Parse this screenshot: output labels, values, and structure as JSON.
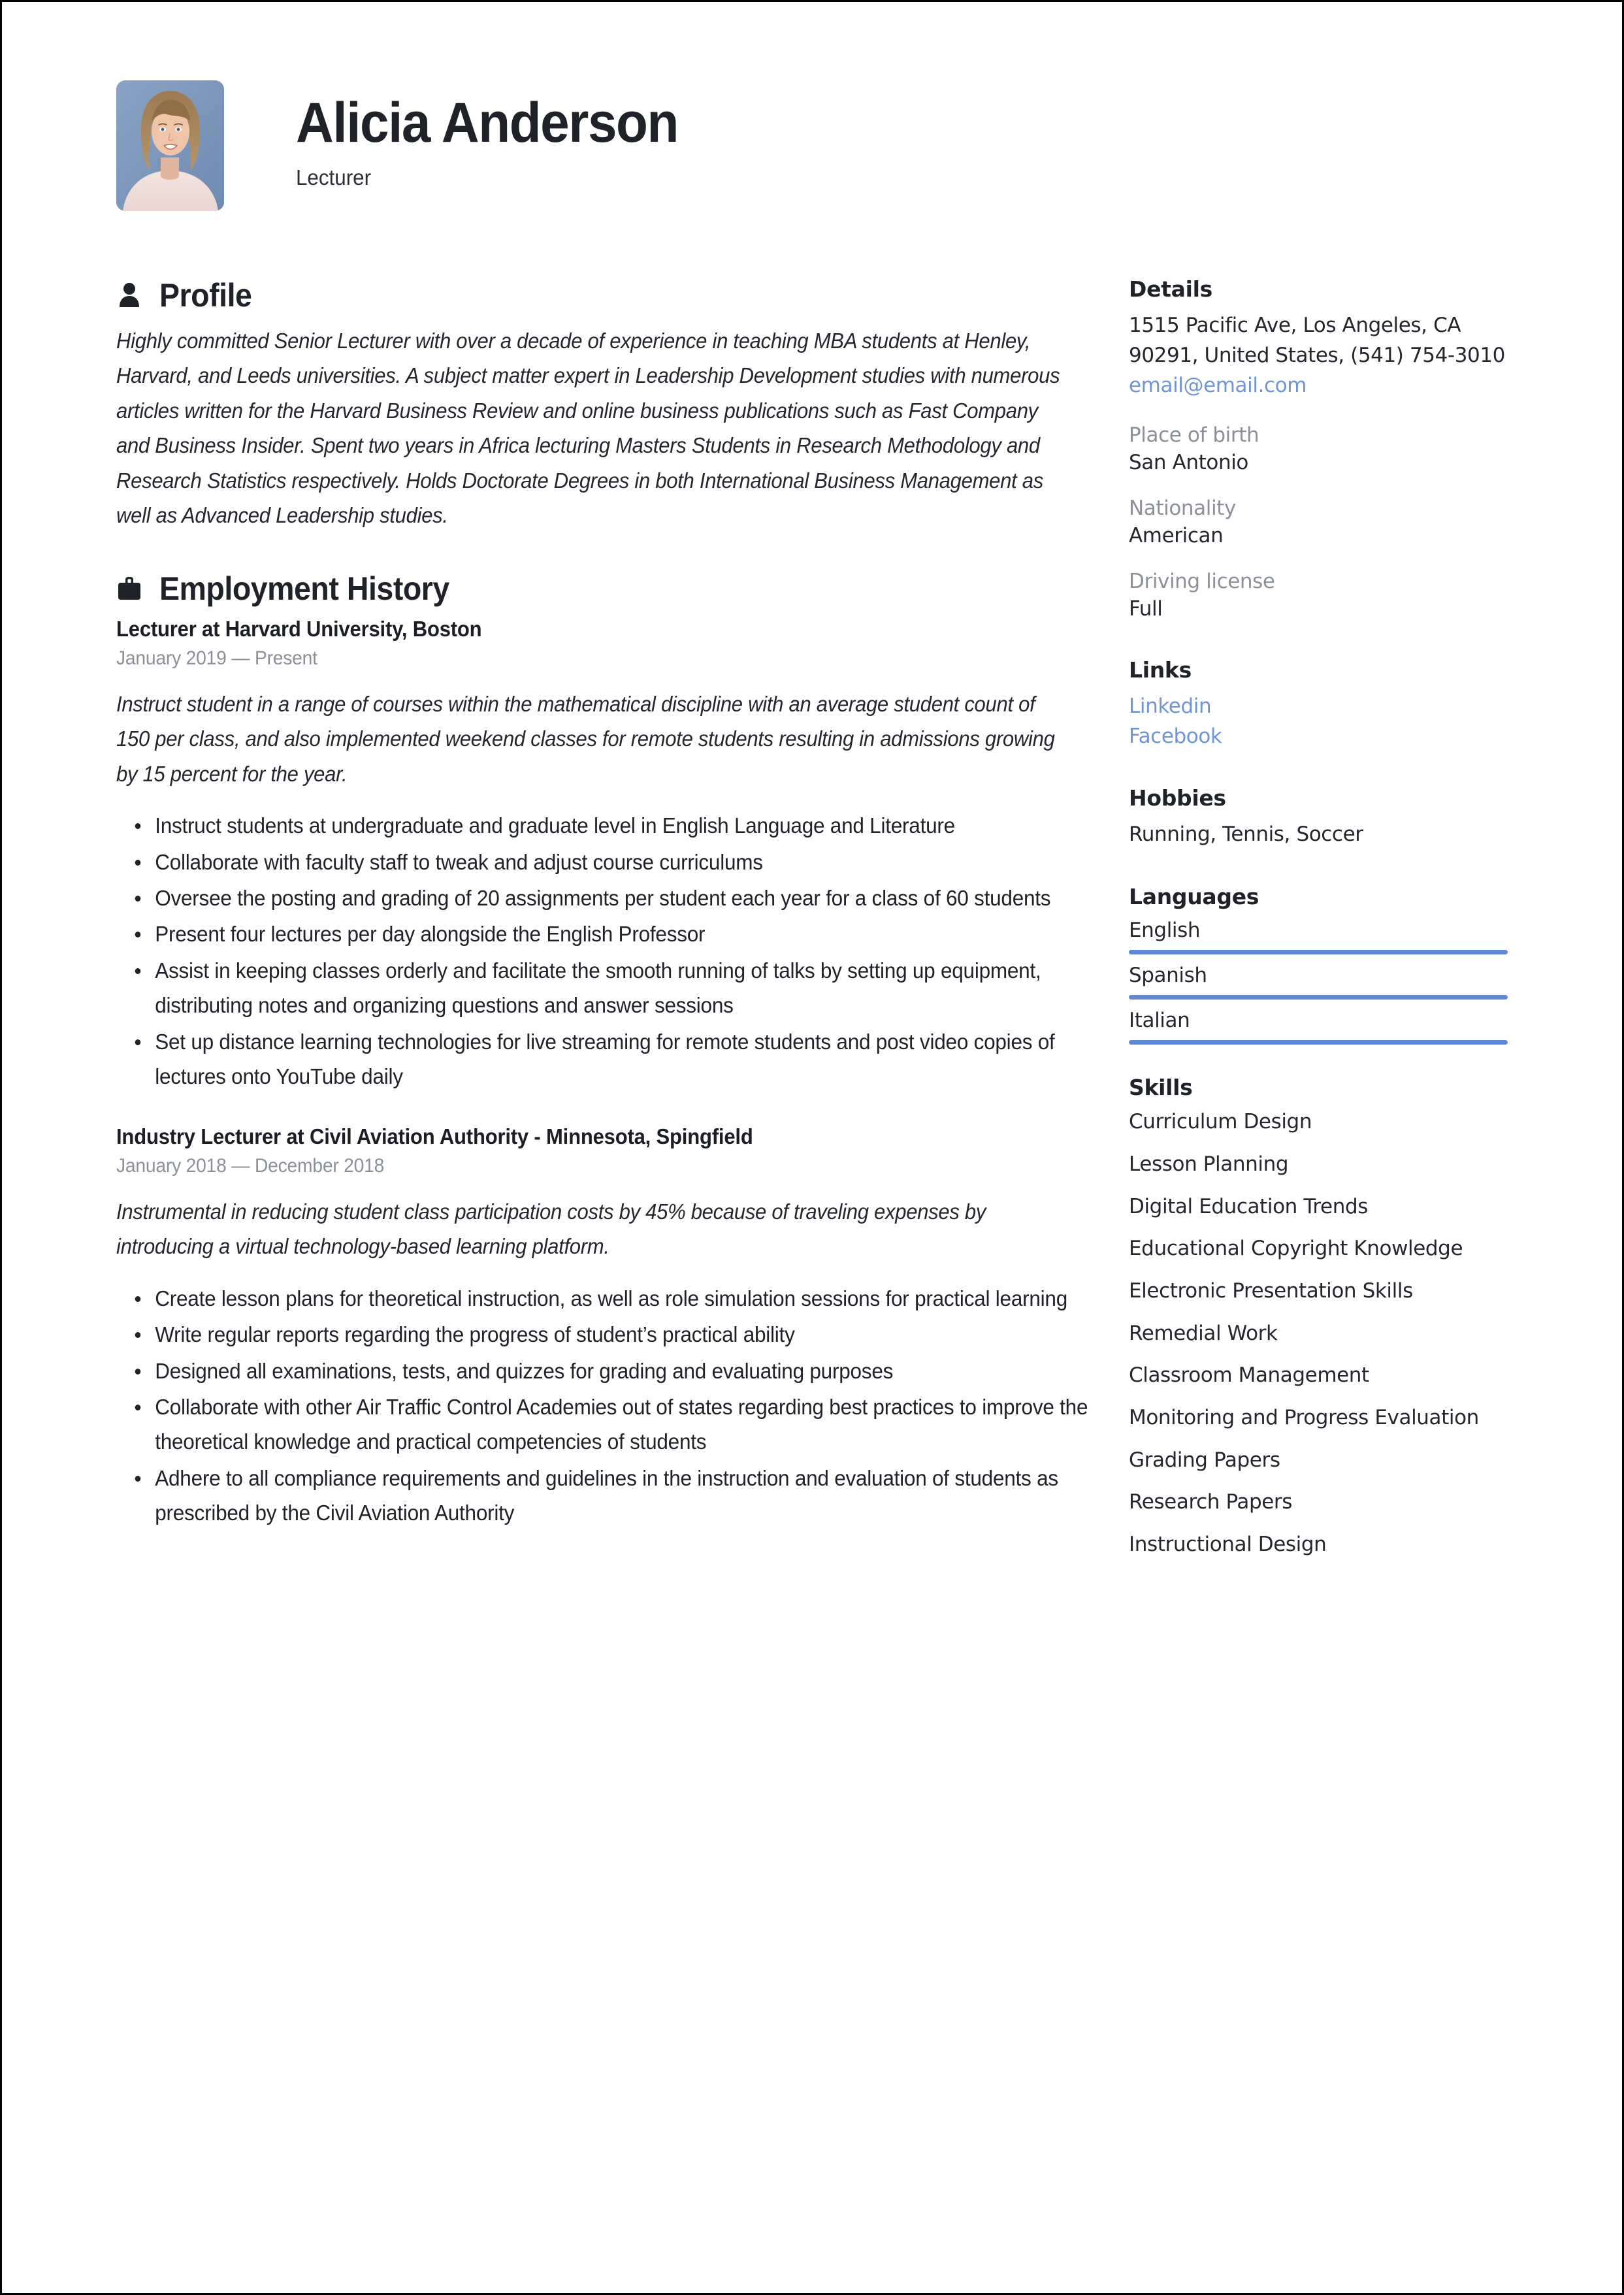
{
  "header": {
    "name": "Alicia Anderson",
    "job_title": "Lecturer",
    "avatar_alt": "portrait-photo"
  },
  "left": {
    "profile": {
      "icon": "person-icon",
      "title": "Profile",
      "text": "Highly committed Senior Lecturer with over a decade of experience in teaching MBA students at Henley, Harvard, and Leeds universities. A subject matter expert in Leadership Development studies with numerous articles written for the Harvard Business Review and online business publications such as Fast Company and Business Insider. Spent two years in Africa lecturing Masters Students in Research Methodology and Research Statistics respectively. Holds Doctorate Degrees in both International Business Management as well as Advanced Leadership studies."
    },
    "employment": {
      "icon": "briefcase-icon",
      "title": "Employment History",
      "jobs": [
        {
          "heading": "Lecturer at  Harvard University, Boston",
          "dates": "January 2019 — Present",
          "description": "Instruct student in a range of courses within the mathematical discipline with an average student count of 150 per class, and also implemented weekend classes for remote students resulting in admissions growing by 15 percent for the year.",
          "bullets": [
            "Instruct students at undergraduate and graduate level in English Language and Literature",
            "Collaborate with faculty staff to tweak and adjust course curriculums",
            "Oversee the posting and grading of 20 assignments per student each year for a class of 60 students",
            "Present four lectures per day alongside the English Professor",
            "Assist in keeping classes orderly and facilitate the smooth running of talks by setting up equipment, distributing notes and organizing questions and answer sessions",
            "Set up distance learning technologies for live streaming for remote students and post video copies of lectures onto YouTube daily"
          ]
        },
        {
          "heading": "Industry Lecturer at  Civil Aviation Authority - Minnesota, Spingfield",
          "dates": "January 2018 — December 2018",
          "description": "Instrumental in reducing student class participation costs by 45% because of traveling expenses by introducing a virtual technology-based learning platform.",
          "bullets": [
            "Create lesson plans for theoretical instruction, as well as role simulation sessions for practical learning",
            "Write regular reports regarding the progress of student’s practical ability",
            "Designed all examinations, tests, and quizzes for grading and evaluating purposes",
            "Collaborate with other Air Traffic Control Academies out of states regarding best practices to improve the theoretical knowledge and practical competencies of students",
            "Adhere to all compliance requirements and guidelines in the instruction and evaluation of students as prescribed by the Civil Aviation Authority"
          ]
        }
      ]
    }
  },
  "sidebar": {
    "details": {
      "title": "Details",
      "address": "1515 Pacific Ave, Los Angeles, CA 90291, United States, (541) 754-3010",
      "email": "email@email.com",
      "fields": [
        {
          "label": "Place of birth",
          "value": "San Antonio"
        },
        {
          "label": "Nationality",
          "value": "American"
        },
        {
          "label": "Driving license",
          "value": "Full"
        }
      ]
    },
    "links": {
      "title": "Links",
      "items": [
        "Linkedin",
        "Facebook"
      ]
    },
    "hobbies": {
      "title": "Hobbies",
      "text": "Running, Tennis, Soccer"
    },
    "languages": {
      "title": "Languages",
      "items": [
        {
          "name": "English",
          "level": 100
        },
        {
          "name": "Spanish",
          "level": 100
        },
        {
          "name": "Italian",
          "level": 100
        }
      ]
    },
    "skills": {
      "title": "Skills",
      "items": [
        "Curriculum Design",
        "Lesson Planning",
        "Digital Education Trends",
        "Educational Copyright Knowledge",
        "Electronic Presentation Skills",
        "Remedial Work",
        "Classroom Management",
        "Monitoring and Progress Evaluation",
        "Grading Papers",
        "Research Papers",
        "Instructional Design"
      ]
    }
  },
  "colors": {
    "accent_blue": "#6289d8",
    "link_blue": "#7195d4",
    "muted_gray": "#8b9099",
    "text_dark": "#1f2228",
    "photo_bg": "#7e99bd"
  }
}
